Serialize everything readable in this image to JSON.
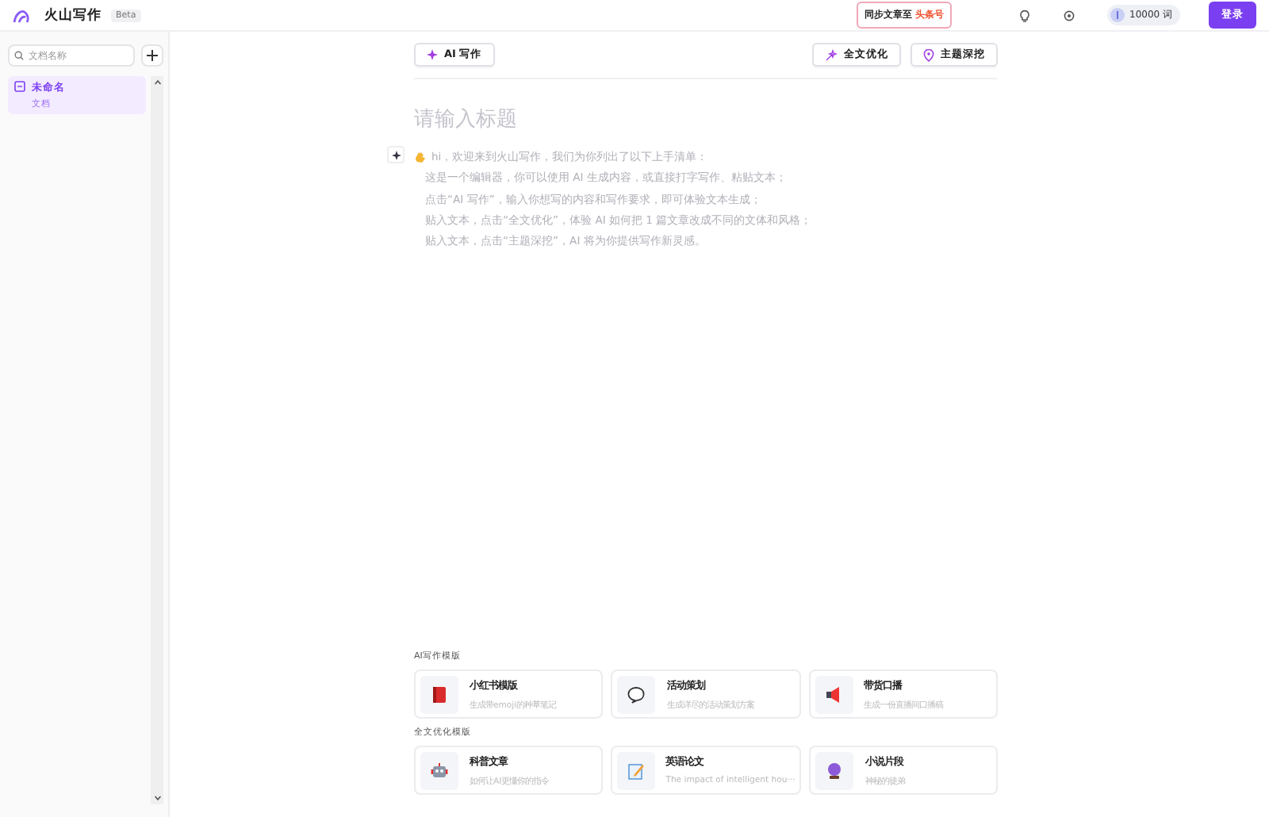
{
  "header": {
    "logo": "火山写作",
    "badge": "Beta",
    "sync": {
      "label": "同步文章至",
      "brand": "头条号"
    },
    "credits": "10000 词",
    "login": "登录"
  },
  "sidebar": {
    "search": {
      "placeholder": "文档名称"
    },
    "items": [
      {
        "title": "未命名",
        "subtitle": "文档",
        "selected": true
      }
    ]
  },
  "toolbar": {
    "left": "AI 写作",
    "right": [
      "全文优化",
      "主题深挖"
    ]
  },
  "editor": {
    "title_placeholder": "请输入标题",
    "intro": "hi，欢迎来到火山写作，我们为你列出了以下上手清单：",
    "lines": [
      "这是一个编辑器，你可以使用 AI 生成内容，或直接打字写作、粘贴文本；",
      "点击“AI 写作”，输入你想写的内容和写作要求，即可体验文本生成；",
      "贴入文本，点击“全文优化”，体验 AI 如何把 1 篇文章改成不同的文体和风格；",
      "贴入文本，点击“主题深挖”，AI 将为你提供写作新灵感。"
    ]
  },
  "template_groups": [
    {
      "heading": "AI写作模版",
      "cards": [
        {
          "kind": "book",
          "title": "小红书模版",
          "desc": "生成带emoji的种草笔记"
        },
        {
          "kind": "bubble",
          "title": "活动策划",
          "desc": "生成详尽的活动策划方案"
        },
        {
          "kind": "megaphone",
          "title": "带货口播",
          "desc": "生成一份直播间口播稿"
        }
      ]
    },
    {
      "heading": "全文优化模版",
      "cards": [
        {
          "kind": "robot",
          "title": "科普文章",
          "desc": "如何让AI更懂你的指令"
        },
        {
          "kind": "memo",
          "title": "英语论文",
          "desc": "The impact of intelligent hou···"
        },
        {
          "kind": "ball",
          "title": "小说片段",
          "desc": "神秘的徒弟"
        }
      ]
    }
  ]
}
